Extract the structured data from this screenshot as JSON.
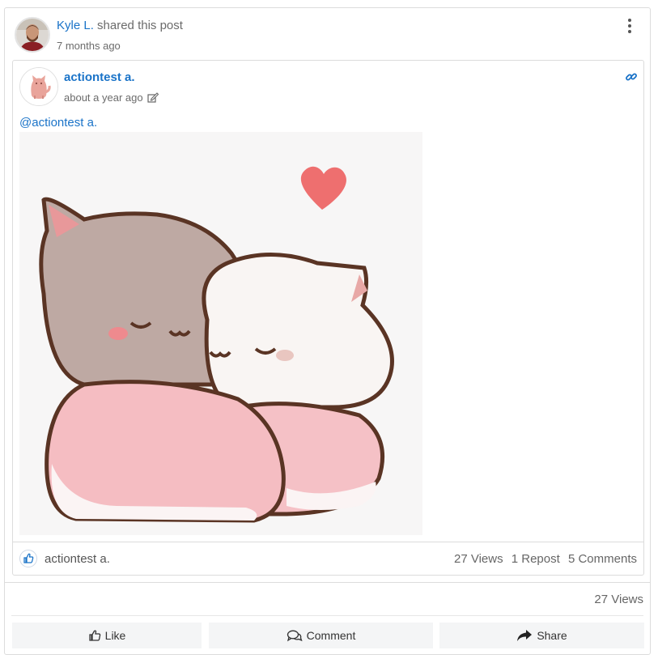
{
  "shared_by": {
    "name": "Kyle L.",
    "action": "shared this post",
    "time": "7 months ago",
    "avatar_icon": "user-photo-avatar",
    "more_icon": "vertical-ellipsis-icon"
  },
  "post": {
    "author": "actiontest a.",
    "time": "about a year ago",
    "edited_icon": "edit-icon",
    "permalink_icon": "link-icon",
    "mention": "@actiontest a.",
    "image_subject": "hugging cats illustration"
  },
  "reactions": {
    "like_icon": "thumbs-up-icon",
    "liker": "actiontest a.",
    "views": "27 Views",
    "reposts": "1 Repost",
    "comments": "5 Comments"
  },
  "outer_stats": {
    "views": "27 Views"
  },
  "actions": {
    "like": "Like",
    "comment": "Comment",
    "share": "Share"
  },
  "colors": {
    "link": "#1a73c8",
    "button_bg": "#f4f5f6",
    "border": "#dcdcdc"
  }
}
